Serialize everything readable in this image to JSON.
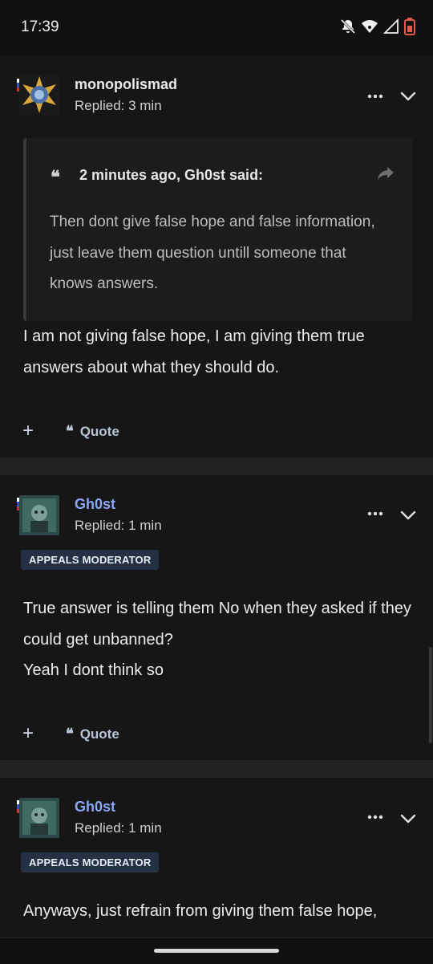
{
  "status_bar": {
    "time": "17:39"
  },
  "posts": [
    {
      "username": "monopolismad",
      "username_color": "#eaeaea",
      "replied": "Replied: 3 min",
      "quote": {
        "attribution": "2 minutes ago, Gh0st said:",
        "text": "Then dont give false hope and false information, just leave them question untill someone that knows answers."
      },
      "body": [
        "I am not giving false hope, I am giving them true answers about what they should do."
      ],
      "actions": {
        "quote_label": "Quote"
      }
    },
    {
      "username": "Gh0st",
      "username_color": "#8aa8f5",
      "replied": "Replied: 1 min",
      "badge": "APPEALS MODERATOR",
      "body": [
        "True answer is telling them No when they asked if they could get unbanned?",
        "Yeah I dont think so"
      ],
      "actions": {
        "quote_label": "Quote"
      }
    },
    {
      "username": "Gh0st",
      "username_color": "#8aa8f5",
      "replied": "Replied: 1 min",
      "badge": "APPEALS MODERATOR",
      "body": [
        "Anyways, just refrain from giving them false hope,"
      ]
    }
  ],
  "icons": {
    "more": "more-horizontal-icon",
    "chevron": "chevron-down-icon",
    "plus": "plus-icon",
    "quote": "quote-icon",
    "share": "share-icon"
  }
}
